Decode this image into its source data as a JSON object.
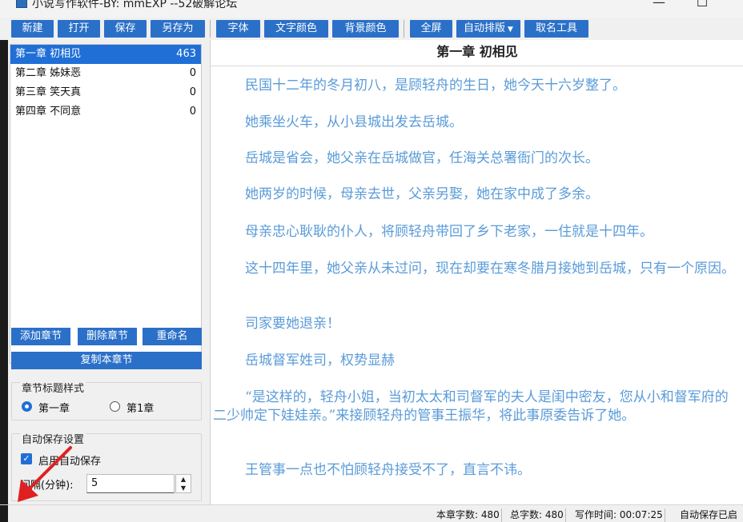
{
  "window": {
    "title": "小说写作软件-BY: mmEXP --52破解论坛",
    "minimize": "—",
    "maximize": "☐"
  },
  "toolbar": {
    "new": "新建",
    "open": "打开",
    "save": "保存",
    "save_as": "另存为",
    "font": "字体",
    "text_color": "文字颜色",
    "bg_color": "背景颜色",
    "fullscreen": "全屏",
    "auto_layout": "自动排版",
    "naming_tool": "取名工具"
  },
  "chapters": [
    {
      "title": "第一章 初相见",
      "count": "463"
    },
    {
      "title": "第二章 姊妹恶",
      "count": "0"
    },
    {
      "title": "第三章 笑天真",
      "count": "0"
    },
    {
      "title": "第四章 不同意",
      "count": "0"
    }
  ],
  "chapter_actions": {
    "add": "添加章节",
    "delete": "删除章节",
    "rename": "重命名",
    "copy": "复制本章节"
  },
  "title_style": {
    "label": "章节标题样式",
    "option1": "第一章",
    "option2": "第1章",
    "selected": "第一章"
  },
  "autosave": {
    "label": "自动保存设置",
    "enable_label": "启用自动保存",
    "enabled": true,
    "interval_label": "间隔(分钟):",
    "interval_value": "5"
  },
  "editor": {
    "chapter_title": "第一章  初相见",
    "paragraphs": [
      "民国十二年的冬月初八，是顾轻舟的生日，她今天十六岁整了。",
      "她乘坐火车，从小县城出发去岳城。",
      "岳城是省会，她父亲在岳城做官，任海关总署衙门的次长。",
      "她两岁的时候，母亲去世，父亲另娶，她在家中成了多余。",
      "母亲忠心耿耿的仆人，将顾轻舟带回了乡下老家，一住就是十四年。",
      "这十四年里，她父亲从未过问，现在却要在寒冬腊月接她到岳城，只有一个原因。",
      "司家要她退亲！",
      "岳城督军姓司，权势显赫",
      "“是这样的，轻舟小姐，当初太太和司督军的夫人是闺中密友，您从小和督军府的二少帅定下娃娃亲。”来接顾轻舟的管事王振华，将此事原委告诉了她。",
      "王管事一点也不怕顾轻舟接受不了，直言不讳。"
    ]
  },
  "status": {
    "chapter_words": "本章字数: 480",
    "total_words": "总字数: 480",
    "writing_time": "写作时间: 00:07:25",
    "autosave_status": "自动保存已启"
  },
  "colors": {
    "button_blue": "#2b70c8",
    "selection_blue": "#1f6fd6",
    "text_blue": "#5a9bd8",
    "annotation_red": "#e02020"
  }
}
